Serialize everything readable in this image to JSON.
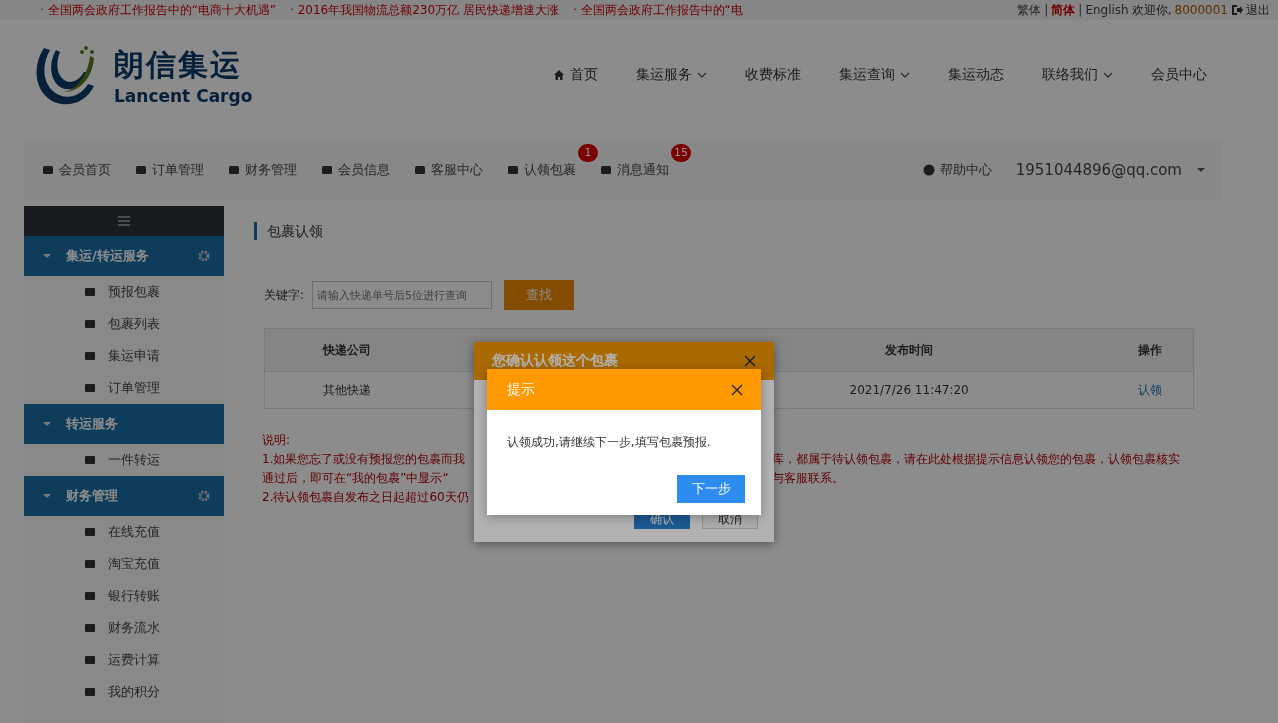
{
  "ticker": [
    "· 全国两会政府工作报告中的“电商十大机遇”",
    "· 2016年我国物流总额230万亿 居民快递增速大涨",
    "· 全国两会政府工作报告中的“电"
  ],
  "languages": [
    {
      "label": "繁体",
      "selected": false
    },
    {
      "label": "简体",
      "selected": true
    },
    {
      "label": "English",
      "selected": false
    }
  ],
  "language_separator": "|",
  "welcome": "欢迎你,",
  "user_id": "8000001",
  "logout": "退出",
  "logo": {
    "name": "朗信集运",
    "subtitle": "Lancent Cargo"
  },
  "nav": [
    {
      "label": "首页",
      "dropdown": false
    },
    {
      "label": "集运服务",
      "dropdown": true
    },
    {
      "label": "收费标准",
      "dropdown": false
    },
    {
      "label": "集运查询",
      "dropdown": true
    },
    {
      "label": "集运动态",
      "dropdown": false
    },
    {
      "label": "联络我们",
      "dropdown": true
    },
    {
      "label": "会员中心",
      "dropdown": false
    }
  ],
  "member_bar": [
    {
      "label": "会员首页"
    },
    {
      "label": "订单管理"
    },
    {
      "label": "财务管理"
    },
    {
      "label": "会员信息"
    },
    {
      "label": "客服中心"
    },
    {
      "label": "认领包裹",
      "badge": "1"
    },
    {
      "label": "消息通知",
      "badge": "15"
    }
  ],
  "help": "帮助中心",
  "account": "1951044896@qq.com",
  "sidebar": [
    {
      "label": "集运/转运服务",
      "expanded": true,
      "gear": true,
      "children": [
        "预报包裹",
        "包裹列表",
        "集运申请",
        "订单管理"
      ]
    },
    {
      "label": "转运服务",
      "expanded": true,
      "gear": false,
      "children": [
        "一件转运"
      ]
    },
    {
      "label": "财务管理",
      "expanded": true,
      "gear": true,
      "children": [
        "在线充值",
        "淘宝充值",
        "银行转账",
        "财务流水",
        "运费计算",
        "我的积分"
      ]
    }
  ],
  "page_title": "包裹认领",
  "search": {
    "label": "关键字:",
    "placeholder": "请输入快递单号后5位进行查询",
    "button": "查找"
  },
  "table": {
    "columns": [
      "快递公司",
      "发布时间",
      "操作"
    ],
    "rows": [
      {
        "company": "其他快递",
        "time": "2021/7/26 11:47:20",
        "action": "认领"
      }
    ]
  },
  "notes": {
    "heading": "说明:",
    "left": [
      "1.如果您忘了或没有预报您的包裹而我",
      "通过后，即可在“我的包裹”中显示“",
      "2.待认领包裹自发布之日起超过60天仍"
    ],
    "right": [
      "库，都属于待认领包裹，请在此处根据提示信息认领您的包裹，认领包裹核实",
      "与客服联系。"
    ]
  },
  "confirm_dialog": {
    "title": "您确认认领这个包裹",
    "buttons": [
      "确认",
      "取消"
    ]
  },
  "alert_dialog": {
    "title": "提示",
    "message": "认领成功,请继续下一步,填写包裹预报.",
    "button": "下一步"
  }
}
